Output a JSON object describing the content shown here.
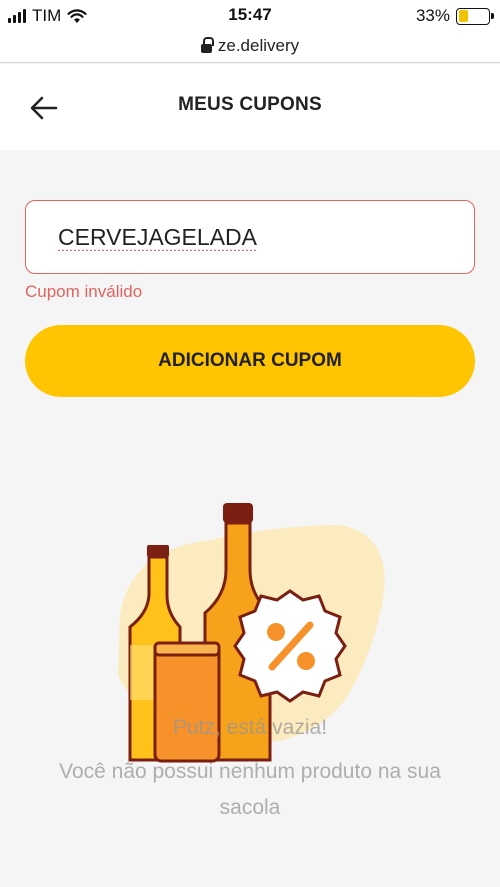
{
  "status_bar": {
    "carrier": "TIM",
    "time": "15:47",
    "battery_percent": "33%",
    "battery_level": 0.33,
    "icons": [
      "signal-icon",
      "wifi-icon",
      "battery-icon"
    ]
  },
  "browser": {
    "url": "ze.delivery"
  },
  "header": {
    "title": "MEUS CUPONS",
    "back_icon": "arrow-left-icon"
  },
  "coupon_form": {
    "input_value": "CERVEJAGELADA",
    "error_message": "Cupom inválido",
    "submit_label": "ADICIONAR CUPOM"
  },
  "empty_state": {
    "title": "Putz, está vazia!",
    "message": "Você não possui nenhum produto na sua sacola",
    "illustration": "beer-bottles-coupon-illustration"
  },
  "colors": {
    "accent": "#ffc500",
    "error": "#e0645f",
    "background": "#f5f5f5",
    "bottle_outline": "#7a1f12"
  }
}
